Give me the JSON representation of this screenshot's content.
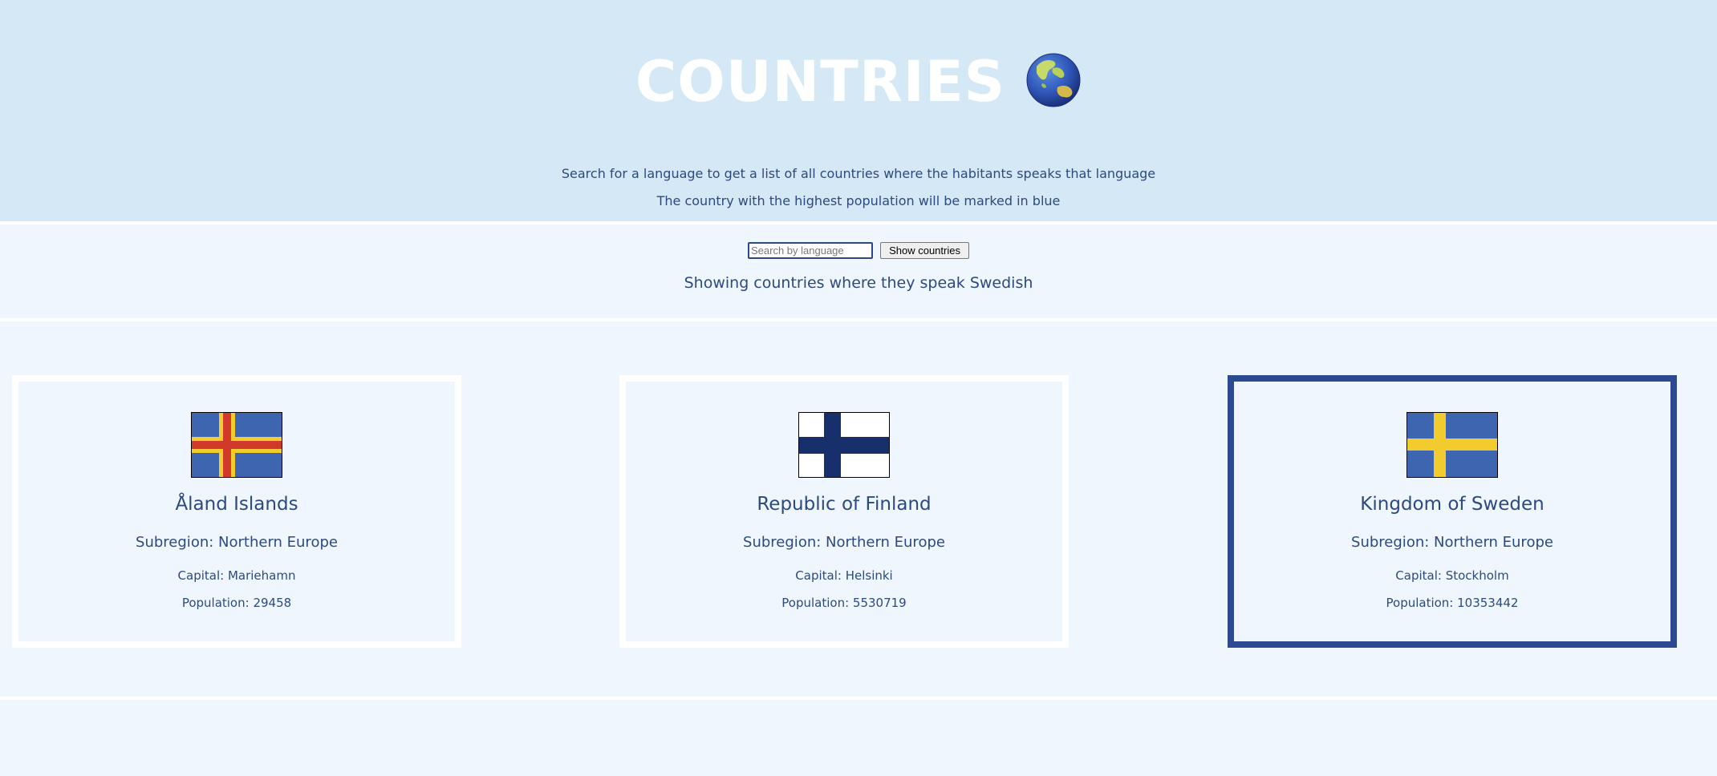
{
  "header": {
    "title": "COUNTRIES",
    "globe_icon": "globe-asia-australia-icon",
    "description_line1": "Search for a language to get a list of all countries where the habitants speaks that language",
    "description_line2": "The country with the highest population will be marked in blue"
  },
  "search": {
    "placeholder": "Search by language",
    "value": "",
    "button_label": "Show countries",
    "result_text": "Showing countries where they speak Swedish"
  },
  "countries": [
    {
      "name": "Åland Islands",
      "subregion": "Subregion: Northern Europe",
      "capital": "Capital: Mariehamn",
      "population": "Population: 29458",
      "flag_icon": "aland-flag-icon",
      "highlighted": false
    },
    {
      "name": "Republic of Finland",
      "subregion": "Subregion: Northern Europe",
      "capital": "Capital: Helsinki",
      "population": "Population: 5530719",
      "flag_icon": "finland-flag-icon",
      "highlighted": false
    },
    {
      "name": "Kingdom of Sweden",
      "subregion": "Subregion: Northern Europe",
      "capital": "Capital: Stockholm",
      "population": "Population: 10353442",
      "flag_icon": "sweden-flag-icon",
      "highlighted": true
    }
  ],
  "colors": {
    "header_bg": "#d5e8f5",
    "page_bg": "#f0f6fd",
    "text": "#2c4a80",
    "highlight_border": "#2b4a92"
  }
}
